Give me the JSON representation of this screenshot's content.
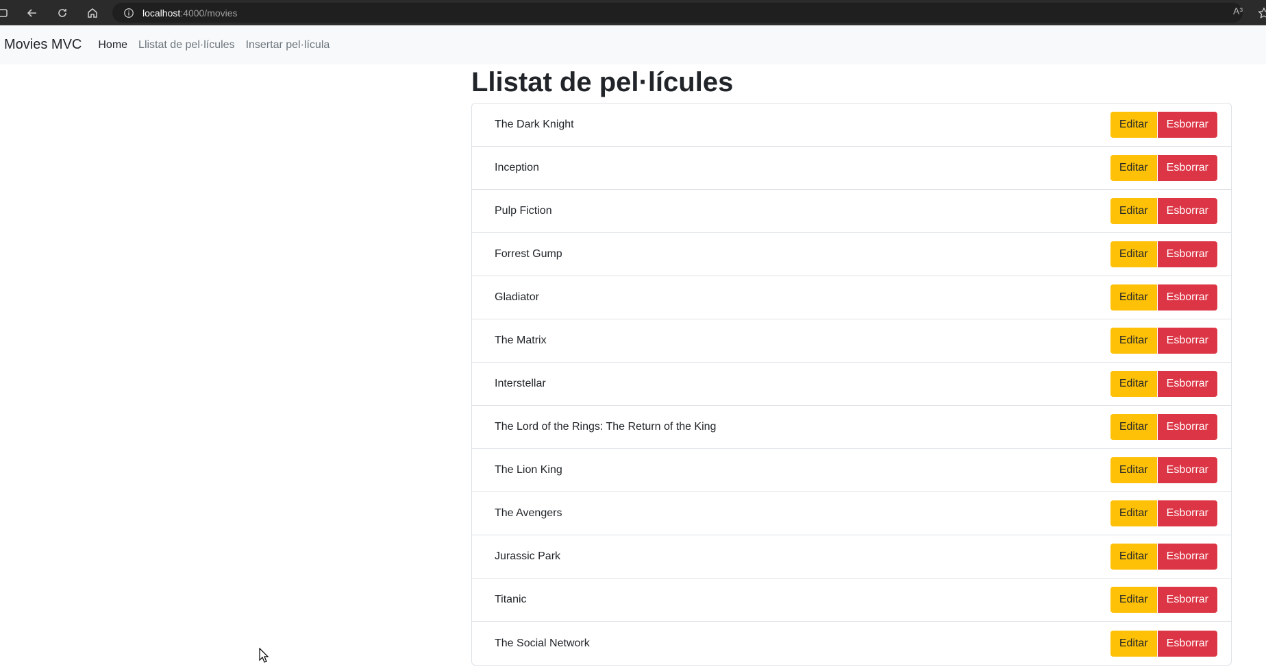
{
  "browser": {
    "url_host": "localhost",
    "url_rest": ":4000/movies",
    "read_aloud_label": "A³"
  },
  "navbar": {
    "brand": "Movies MVC",
    "links": [
      {
        "label": "Home",
        "active": true
      },
      {
        "label": "Llistat de pel·lícules",
        "active": false
      },
      {
        "label": "Insertar pel·lícula",
        "active": false
      }
    ]
  },
  "main": {
    "title": "Llistat de pel·lícules",
    "edit_label": "Editar",
    "delete_label": "Esborrar",
    "movies": [
      "The Dark Knight",
      "Inception",
      "Pulp Fiction",
      "Forrest Gump",
      "Gladiator",
      "The Matrix",
      "Interstellar",
      "The Lord of the Rings: The Return of the King",
      "The Lion King",
      "The Avengers",
      "Jurassic Park",
      "Titanic",
      "The Social Network"
    ]
  },
  "colors": {
    "edit_button": "#ffc107",
    "delete_button": "#dc3545",
    "navbar_bg": "#f8f9fa"
  }
}
